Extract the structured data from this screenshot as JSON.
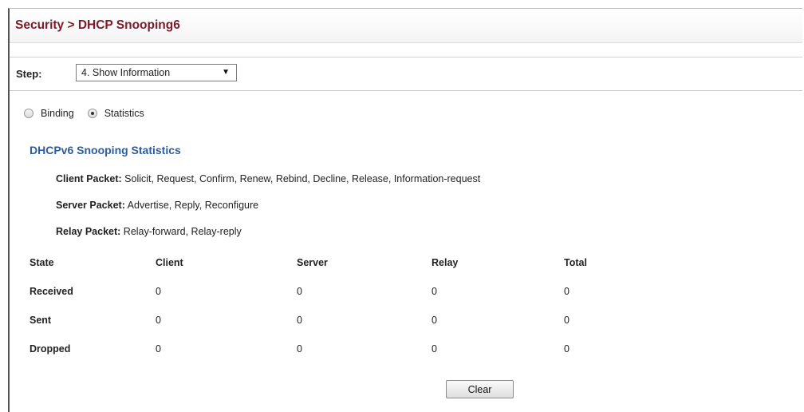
{
  "breadcrumb": "Security > DHCP Snooping6",
  "step": {
    "label": "Step:",
    "selected": "4. Show Information"
  },
  "view_options": [
    {
      "label": "Binding",
      "checked": false
    },
    {
      "label": "Statistics",
      "checked": true
    }
  ],
  "section_title": "DHCPv6 Snooping Statistics",
  "packet_info": {
    "client": {
      "label": "Client Packet:",
      "value": "Solicit, Request, Confirm, Renew, Rebind, Decline, Release, Information-request"
    },
    "server": {
      "label": "Server Packet:",
      "value": "Advertise, Reply, Reconfigure"
    },
    "relay": {
      "label": "Relay Packet:",
      "value": "Relay-forward, Relay-reply"
    }
  },
  "stats": {
    "columns": [
      "State",
      "Client",
      "Server",
      "Relay",
      "Total"
    ],
    "rows": [
      {
        "state": "Received",
        "client": "0",
        "server": "0",
        "relay": "0",
        "total": "0"
      },
      {
        "state": "Sent",
        "client": "0",
        "server": "0",
        "relay": "0",
        "total": "0"
      },
      {
        "state": "Dropped",
        "client": "0",
        "server": "0",
        "relay": "0",
        "total": "0"
      }
    ]
  },
  "clear_label": "Clear",
  "colors": {
    "title": "#7b1b2a",
    "section_heading": "#2e5c9a"
  }
}
